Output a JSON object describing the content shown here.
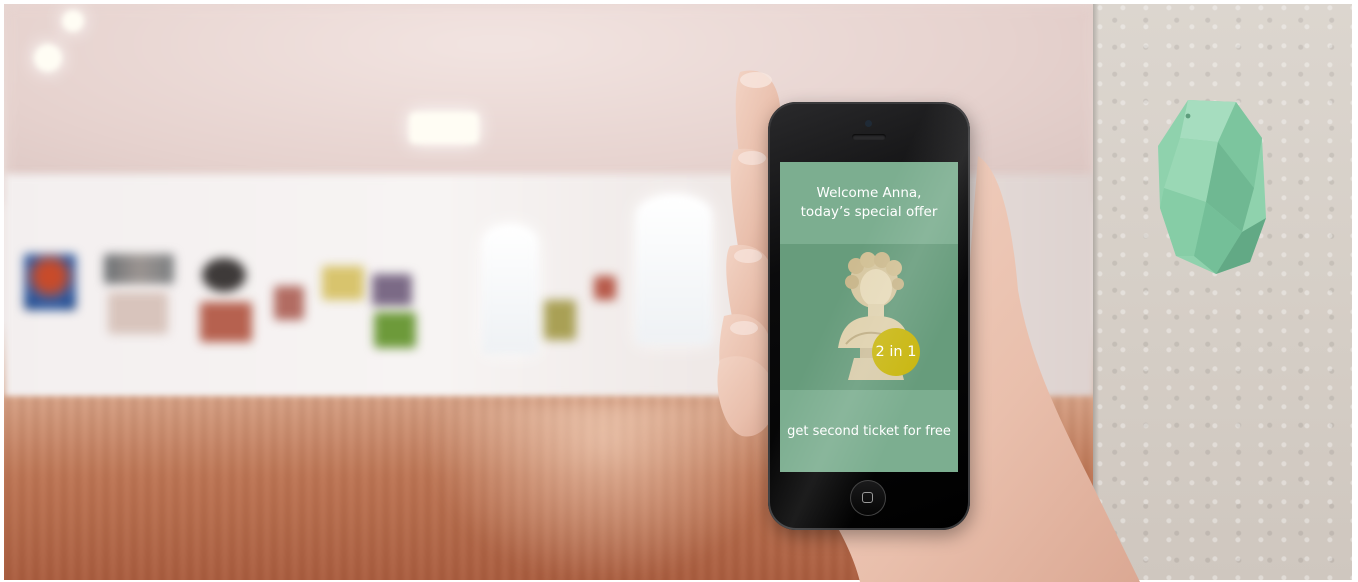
{
  "screen": {
    "greeting_line1": "Welcome Anna,",
    "greeting_line2": "today’s special offer",
    "offer_badge": "2 in 1",
    "offer_text": "get second ticket for free"
  },
  "colors": {
    "screen_green": "#7cae90",
    "screen_green_dark": "#679c7c",
    "badge_yellow": "#c9b711",
    "beacon_mint": "#8fd2ad"
  },
  "icons": {
    "home_button": "home-button-icon",
    "beacon": "beacon-device-icon",
    "bust": "statue-bust-icon"
  }
}
